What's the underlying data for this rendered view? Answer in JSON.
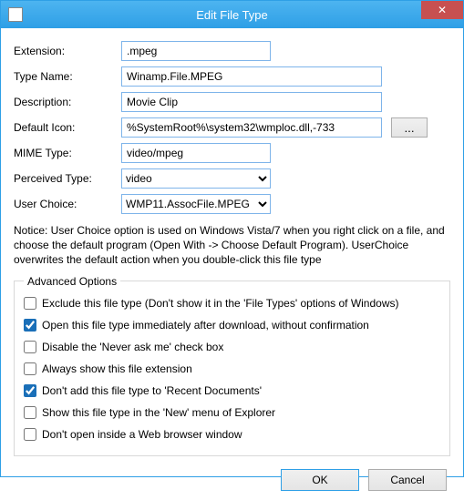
{
  "window": {
    "title": "Edit File Type",
    "close_symbol": "✕"
  },
  "fields": {
    "extension": {
      "label": "Extension:",
      "value": ".mpeg"
    },
    "type_name": {
      "label": "Type Name:",
      "value": "Winamp.File.MPEG"
    },
    "description": {
      "label": "Description:",
      "value": "Movie Clip"
    },
    "default_icon": {
      "label": "Default Icon:",
      "value": "%SystemRoot%\\system32\\wmploc.dll,-733",
      "browse": "..."
    },
    "mime_type": {
      "label": "MIME Type:",
      "value": "video/mpeg"
    },
    "perceived_type": {
      "label": "Perceived Type:",
      "value": "video"
    },
    "user_choice": {
      "label": "User Choice:",
      "value": "WMP11.AssocFile.MPEG"
    }
  },
  "notice": "Notice: User Choice option is used on Windows Vista/7 when you right click on a file, and choose the default program (Open With -> Choose Default Program). UserChoice overwrites the default action when you double-click this file type",
  "advanced": {
    "legend": "Advanced Options",
    "exclude": {
      "label": "Exclude  this file type (Don't show it in the 'File Types' options of Windows)",
      "checked": false
    },
    "open_immediately": {
      "label": "Open this file type immediately after download, without confirmation",
      "checked": true
    },
    "disable_never_ask": {
      "label": "Disable the 'Never ask me' check box",
      "checked": false
    },
    "always_show_ext": {
      "label": "Always show this file extension",
      "checked": false
    },
    "no_recent": {
      "label": "Don't add this file type to 'Recent Documents'",
      "checked": true
    },
    "show_in_new": {
      "label": "Show this file type in the 'New' menu of Explorer",
      "checked": false
    },
    "no_browser": {
      "label": "Don't open inside a Web browser window",
      "checked": false
    }
  },
  "buttons": {
    "ok": "OK",
    "cancel": "Cancel"
  }
}
